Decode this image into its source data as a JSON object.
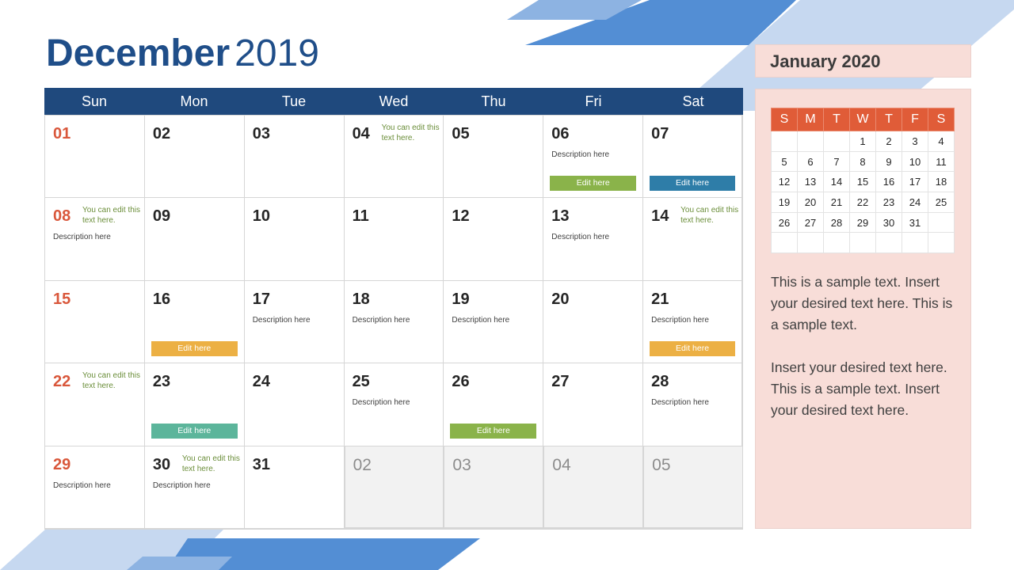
{
  "title": {
    "month": "December",
    "year": "2019"
  },
  "weekdays": [
    "Sun",
    "Mon",
    "Tue",
    "Wed",
    "Thu",
    "Fri",
    "Sat"
  ],
  "colors": {
    "header_blue": "#1f497d",
    "title_blue": "#1f4e89",
    "sunday_red": "#d9573b",
    "note_green": "#6b8e3a",
    "btn_green": "#8ab34a",
    "btn_blue": "#2e7da8",
    "btn_yellow": "#ecb044",
    "btn_teal": "#5cb59b",
    "mini_header": "#e05c38",
    "panel_pink": "#f8ddd8"
  },
  "days": [
    {
      "num": "01"
    },
    {
      "num": "02"
    },
    {
      "num": "03"
    },
    {
      "num": "04",
      "note": "You can edit this text here."
    },
    {
      "num": "05"
    },
    {
      "num": "06",
      "desc": "Description here",
      "button": "Edit here",
      "btn_color": "#8ab34a"
    },
    {
      "num": "07",
      "button": "Edit here",
      "btn_color": "#2e7da8"
    },
    {
      "num": "08",
      "note": "You can edit this text here.",
      "desc": "Description here"
    },
    {
      "num": "09"
    },
    {
      "num": "10"
    },
    {
      "num": "11"
    },
    {
      "num": "12"
    },
    {
      "num": "13",
      "desc": "Description here"
    },
    {
      "num": "14",
      "note": "You can edit this text here."
    },
    {
      "num": "15"
    },
    {
      "num": "16",
      "button": "Edit here",
      "btn_color": "#ecb044"
    },
    {
      "num": "17",
      "desc": "Description here"
    },
    {
      "num": "18",
      "desc": "Description here"
    },
    {
      "num": "19",
      "desc": "Description here"
    },
    {
      "num": "20"
    },
    {
      "num": "21",
      "desc": "Description here",
      "button": "Edit here",
      "btn_color": "#ecb044"
    },
    {
      "num": "22",
      "note": "You can edit this text here."
    },
    {
      "num": "23",
      "button": "Edit here",
      "btn_color": "#5cb59b"
    },
    {
      "num": "24"
    },
    {
      "num": "25",
      "desc": "Description here"
    },
    {
      "num": "26",
      "button": "Edit here",
      "btn_color": "#8ab34a"
    },
    {
      "num": "27"
    },
    {
      "num": "28",
      "desc": "Description here"
    },
    {
      "num": "29",
      "desc": "Description here"
    },
    {
      "num": "30",
      "note": "You can edit this text here.",
      "desc": "Description here"
    },
    {
      "num": "31"
    },
    {
      "num": "02",
      "other": true
    },
    {
      "num": "03",
      "other": true
    },
    {
      "num": "04",
      "other": true
    },
    {
      "num": "05",
      "other": true
    }
  ],
  "sidebar": {
    "title": "January 2020",
    "mini_weekdays": [
      "S",
      "M",
      "T",
      "W",
      "T",
      "F",
      "S"
    ],
    "mini_weeks": [
      [
        "",
        "",
        "",
        "1",
        "2",
        "3",
        "4"
      ],
      [
        "5",
        "6",
        "7",
        "8",
        "9",
        "10",
        "11"
      ],
      [
        "12",
        "13",
        "14",
        "15",
        "16",
        "17",
        "18"
      ],
      [
        "19",
        "20",
        "21",
        "22",
        "23",
        "24",
        "25"
      ],
      [
        "26",
        "27",
        "28",
        "29",
        "30",
        "31",
        ""
      ],
      [
        "",
        "",
        "",
        "",
        "",
        "",
        ""
      ]
    ],
    "paragraphs": [
      "This is a sample text. Insert your desired text here. This is a sample text.",
      "Insert your desired text here. This is a sample text. Insert your desired text here."
    ]
  }
}
